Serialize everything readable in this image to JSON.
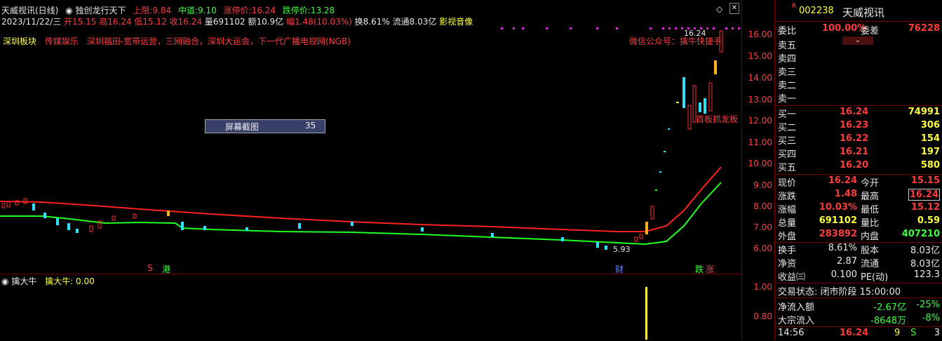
{
  "header": {
    "title": "天威视讯(日线)",
    "indicator_name": "独创龙行天下",
    "upper_label": "上限:",
    "upper_value": "9.84",
    "mid_label": "中道:",
    "mid_value": "9.10",
    "limit_up_label": "涨停价:",
    "limit_up_value": "16.24",
    "limit_down_label": "跌停价:",
    "limit_down_value": "13.28"
  },
  "info_line": {
    "date": "2023/11/22/三",
    "open": "开15.15",
    "high": "高16.24",
    "low": "低15.12",
    "close": "收16.24",
    "volume": "量691102",
    "amount": "额10.9亿",
    "change": "幅1.48(10.03%)",
    "turnover": "换8.61%",
    "float": "流通8.03亿",
    "sector": "影视音像"
  },
  "tags": {
    "board": "深圳板块",
    "industry": "传媒娱乐",
    "concept": "深圳福田-宽带运营，三网融合，深圳大运会，下一代广播电视网(NGB)",
    "wechat": "微信公众号：擒牛快捷手",
    "dragon": "首板抓龙板",
    "peak_label": "16.24",
    "low_label": "5.93"
  },
  "overlay": {
    "screenshot_label": "屏幕截图",
    "screenshot_count": "35"
  },
  "markers": {
    "s": "S",
    "gang": "港",
    "cai": "财",
    "die": "跌",
    "zhang": "涨"
  },
  "price_axis": [
    "16.00",
    "15.00",
    "14.00",
    "13.00",
    "12.00",
    "11.00",
    "10.00",
    "9.00",
    "8.00",
    "7.00",
    "6.00"
  ],
  "sub_chart": {
    "name": "擒大牛",
    "value_label": "擒大牛: 0.00",
    "ticks": [
      "1.00",
      "0.80"
    ]
  },
  "quote": {
    "code": "002238",
    "name": "天威视讯",
    "wb_label": "委比",
    "wb_value": "100.00%",
    "wc_label": "委差",
    "wc_value": "76228",
    "asks": [
      {
        "label": "卖五",
        "price": "",
        "vol": ""
      },
      {
        "label": "卖四",
        "price": "",
        "vol": ""
      },
      {
        "label": "卖三",
        "price": "",
        "vol": ""
      },
      {
        "label": "卖二",
        "price": "",
        "vol": ""
      },
      {
        "label": "卖一",
        "price": "",
        "vol": ""
      }
    ],
    "bids": [
      {
        "label": "买一",
        "price": "16.24",
        "vol": "74991"
      },
      {
        "label": "买二",
        "price": "16.23",
        "vol": "306"
      },
      {
        "label": "买三",
        "price": "16.22",
        "vol": "154"
      },
      {
        "label": "买四",
        "price": "16.21",
        "vol": "197"
      },
      {
        "label": "买五",
        "price": "16.20",
        "vol": "580"
      }
    ],
    "stats1": [
      {
        "l1": "现价",
        "v1": "16.24",
        "l2": "今开",
        "v2": "15.15"
      },
      {
        "l1": "涨跌",
        "v1": "1.48",
        "l2": "最高",
        "v2": "16.24"
      },
      {
        "l1": "涨幅",
        "v1": "10.03%",
        "l2": "最低",
        "v2": "15.12"
      },
      {
        "l1": "总量",
        "v1": "691102",
        "l2": "量比",
        "v2": "0.59"
      },
      {
        "l1": "外盘",
        "v1": "283892",
        "l2": "内盘",
        "v2": "407210"
      }
    ],
    "stats2": [
      {
        "l1": "换手",
        "v1": "8.61%",
        "l2": "股本",
        "v2": "8.03亿"
      },
      {
        "l1": "净资",
        "v1": "2.87",
        "l2": "流通",
        "v2": "8.03亿"
      },
      {
        "l1": "收益㈢",
        "v1": "0.100",
        "l2": "PE(动)",
        "v2": "123.3"
      }
    ],
    "trade_status": "交易状态: 闭市阶段 15:00:00",
    "net_inflow_label": "净流入额",
    "net_inflow_value": "-2.67亿",
    "net_inflow_pct": "-25%",
    "block_inflow_label": "大宗流入",
    "block_inflow_value": "-8648万",
    "block_inflow_pct": "-8%",
    "tick_time": "14:56",
    "tick_price": "16.24",
    "tick_vol": "9",
    "tick_side": "S",
    "tick_count": "3"
  }
}
